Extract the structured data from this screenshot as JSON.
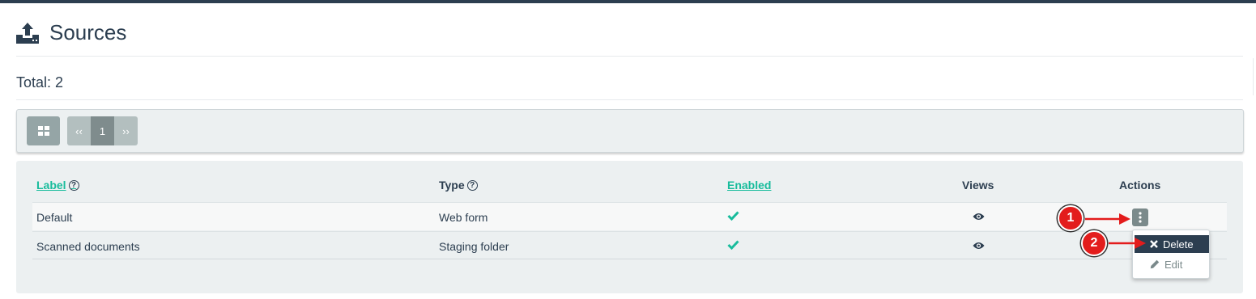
{
  "page": {
    "title": "Sources",
    "total": "Total: 2"
  },
  "pagination": {
    "prev": "‹‹",
    "current": "1",
    "next": "››"
  },
  "table": {
    "headers": {
      "label": "Label",
      "type": "Type",
      "enabled": "Enabled",
      "views": "Views",
      "actions": "Actions"
    },
    "rows": [
      {
        "label": "Default",
        "type": "Web form",
        "enabled": true
      },
      {
        "label": "Scanned documents",
        "type": "Staging folder",
        "enabled": true
      }
    ]
  },
  "dropdown": {
    "delete": "Delete",
    "edit": "Edit"
  },
  "annotations": [
    "1",
    "2"
  ],
  "icons": [
    "upload-icon",
    "grid-view-icon",
    "help-icon",
    "check-icon",
    "eye-icon",
    "vertical-dots-icon",
    "close-icon",
    "pencil-icon"
  ],
  "colors": {
    "accent": "#18bc9c",
    "dark": "#2c3e50",
    "annotation": "#e31c1c"
  }
}
